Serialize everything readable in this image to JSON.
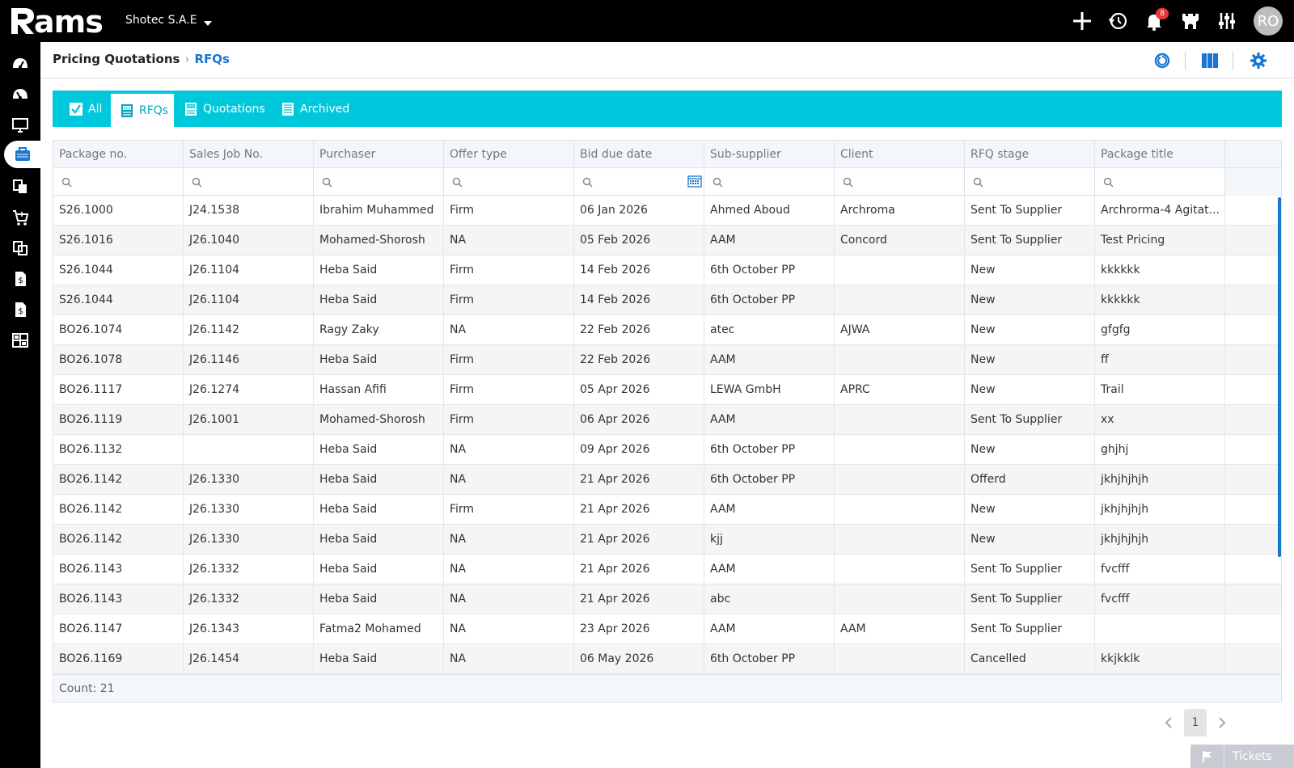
{
  "app": {
    "logo_text": "ams",
    "company": "Shotec S.A.E",
    "notification_count": "8",
    "avatar_initials": "RO"
  },
  "breadcrumb": {
    "root": "Pricing Quotations",
    "current": "RFQs"
  },
  "tabs": [
    {
      "label": "All",
      "icon": "checkbox-icon"
    },
    {
      "label": "RFQs",
      "icon": "inq-document-icon",
      "active": true
    },
    {
      "label": "Quotations",
      "icon": "ofr-document-icon"
    },
    {
      "label": "Archived",
      "icon": "archive-document-icon"
    }
  ],
  "table": {
    "columns": [
      "Package no.",
      "Sales Job No.",
      "Purchaser",
      "Offer type",
      "Bid due date",
      "Sub-supplier",
      "Client",
      "RFQ stage",
      "Package title"
    ],
    "rows": [
      [
        "S26.1000",
        "J24.1538",
        "Ibrahim Muhammed",
        "Firm",
        "06 Jan 2026",
        "Ahmed Aboud",
        "Archroma",
        "Sent To Supplier",
        "Archrorma-4 Agitat..."
      ],
      [
        "S26.1016",
        "J26.1040",
        "Mohamed-Shorosh",
        "NA",
        "05 Feb 2026",
        "AAM",
        "Concord",
        "Sent To Supplier",
        "Test Pricing"
      ],
      [
        "S26.1044",
        "J26.1104",
        "Heba Said",
        "Firm",
        "14 Feb 2026",
        "6th October PP",
        "",
        "New",
        "kkkkkk"
      ],
      [
        "S26.1044",
        "J26.1104",
        "Heba Said",
        "Firm",
        "14 Feb 2026",
        "6th October PP",
        "",
        "New",
        "kkkkkk"
      ],
      [
        "BO26.1074",
        "J26.1142",
        "Ragy Zaky",
        "NA",
        "22 Feb 2026",
        "atec",
        "AJWA",
        "New",
        "gfgfg"
      ],
      [
        "BO26.1078",
        "J26.1146",
        "Heba Said",
        "Firm",
        "22 Feb 2026",
        "AAM",
        "",
        "New",
        "ff"
      ],
      [
        "BO26.1117",
        "J26.1274",
        "Hassan Afifi",
        "Firm",
        "05 Apr 2026",
        "LEWA GmbH",
        "APRC",
        "New",
        "Trail"
      ],
      [
        "BO26.1119",
        "J26.1001",
        "Mohamed-Shorosh",
        "Firm",
        "06 Apr 2026",
        "AAM",
        "",
        "Sent To Supplier",
        "xx"
      ],
      [
        "BO26.1132",
        "",
        "Heba Said",
        "NA",
        "09 Apr 2026",
        "6th October PP",
        "",
        "New",
        "ghjhj"
      ],
      [
        "BO26.1142",
        "J26.1330",
        "Heba Said",
        "NA",
        "21 Apr 2026",
        "6th October PP",
        "",
        "Offerd",
        "jkhjhjhjh"
      ],
      [
        "BO26.1142",
        "J26.1330",
        "Heba Said",
        "Firm",
        "21 Apr 2026",
        "AAM",
        "",
        "New",
        "jkhjhjhjh"
      ],
      [
        "BO26.1142",
        "J26.1330",
        "Heba Said",
        "NA",
        "21 Apr 2026",
        "kjj",
        "",
        "New",
        "jkhjhjhjh"
      ],
      [
        "BO26.1143",
        "J26.1332",
        "Heba Said",
        "NA",
        "21 Apr 2026",
        "AAM",
        "",
        "Sent To Supplier",
        "fvcfff"
      ],
      [
        "BO26.1143",
        "J26.1332",
        "Heba Said",
        "NA",
        "21 Apr 2026",
        "abc",
        "",
        "Sent To Supplier",
        "fvcfff"
      ],
      [
        "BO26.1147",
        "J26.1343",
        "Fatma2 Mohamed",
        "NA",
        "23 Apr 2026",
        "AAM",
        "AAM",
        "Sent To Supplier",
        ""
      ],
      [
        "BO26.1169",
        "J26.1454",
        "Heba Said",
        "NA",
        "06 May 2026",
        "6th October PP",
        "",
        "Cancelled",
        "kkjkklk"
      ]
    ],
    "count_label": "Count: 21"
  },
  "pager": {
    "current_page": "1"
  },
  "tickets": {
    "label": "Tickets"
  },
  "colors": {
    "tab_bar": "#00c8dc",
    "accent": "#1976d2",
    "topbar": "#000000"
  }
}
